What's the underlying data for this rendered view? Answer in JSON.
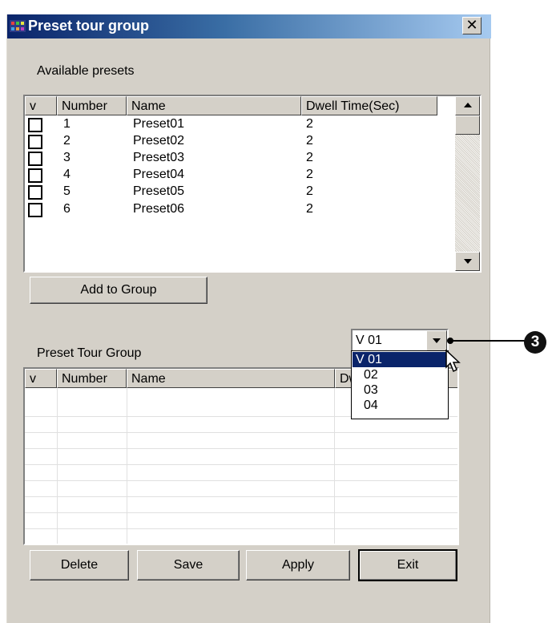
{
  "window": {
    "title": "Preset tour group",
    "close_glyph": "✕"
  },
  "available": {
    "label": "Available presets",
    "columns": [
      "v",
      "Number",
      "Name",
      "Dwell Time(Sec)"
    ],
    "rows": [
      {
        "number": "1",
        "name": "Preset01",
        "dwell": "2"
      },
      {
        "number": "2",
        "name": "Preset02",
        "dwell": "2"
      },
      {
        "number": "3",
        "name": "Preset03",
        "dwell": "2"
      },
      {
        "number": "4",
        "name": "Preset04",
        "dwell": "2"
      },
      {
        "number": "5",
        "name": "Preset05",
        "dwell": "2"
      },
      {
        "number": "6",
        "name": "Preset06",
        "dwell": "2"
      }
    ]
  },
  "add_button": "Add to Group",
  "tour_group": {
    "label": "Preset Tour Group",
    "selected": "V 01",
    "options": [
      "V 01",
      "02",
      "03",
      "04"
    ],
    "columns": [
      "v",
      "Number",
      "Name",
      "Dw"
    ]
  },
  "buttons": {
    "delete": "Delete",
    "save": "Save",
    "apply": "Apply",
    "exit": "Exit"
  },
  "callout": "3",
  "icons": {
    "app": "app-icon",
    "close": "close-icon",
    "scroll_up": "scroll-up-icon",
    "scroll_down": "scroll-down-icon",
    "dropdown": "dropdown-arrow-icon",
    "cursor": "mouse-cursor-icon"
  },
  "colors": {
    "title_start": "#0a246a",
    "title_end": "#a6caf0",
    "face": "#d4d0c8",
    "selection": "#0a246a"
  }
}
